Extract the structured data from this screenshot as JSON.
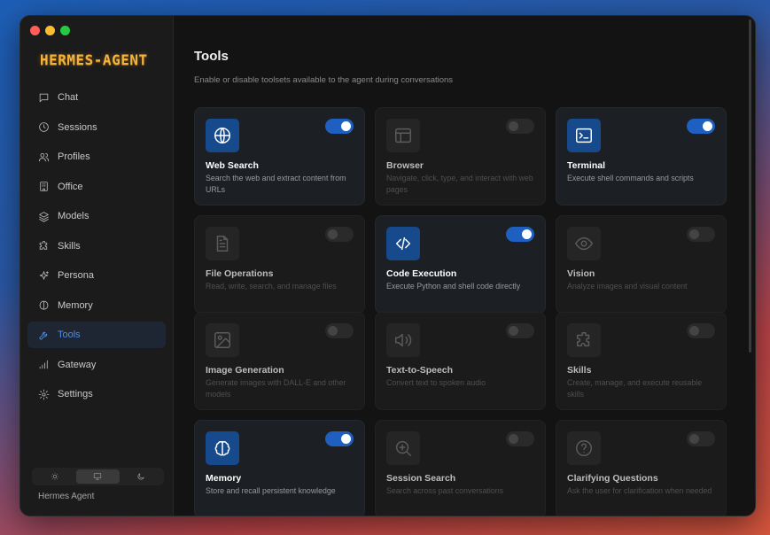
{
  "app": {
    "logo": "HERMES-AGENT",
    "footer_name": "Hermes Agent"
  },
  "sidebar": {
    "items": [
      {
        "label": "Chat",
        "icon": "message-square-icon",
        "active": false
      },
      {
        "label": "Sessions",
        "icon": "clock-icon",
        "active": false
      },
      {
        "label": "Profiles",
        "icon": "users-icon",
        "active": false
      },
      {
        "label": "Office",
        "icon": "building-icon",
        "active": false
      },
      {
        "label": "Models",
        "icon": "layers-icon",
        "active": false
      },
      {
        "label": "Skills",
        "icon": "puzzle-icon",
        "active": false
      },
      {
        "label": "Persona",
        "icon": "sparkle-icon",
        "active": false
      },
      {
        "label": "Memory",
        "icon": "brain-icon",
        "active": false
      },
      {
        "label": "Tools",
        "icon": "wrench-icon",
        "active": true
      },
      {
        "label": "Gateway",
        "icon": "signal-icon",
        "active": false
      },
      {
        "label": "Settings",
        "icon": "gear-icon",
        "active": false
      }
    ],
    "theme_options": [
      "light",
      "system",
      "dark"
    ],
    "theme_selected": "system"
  },
  "page": {
    "title": "Tools",
    "subtitle": "Enable or disable toolsets available to the agent during conversations"
  },
  "tools": [
    {
      "name": "Web Search",
      "description": "Search the web and extract content from URLs",
      "icon": "globe-icon",
      "enabled": true
    },
    {
      "name": "Browser",
      "description": "Navigate, click, type, and interact with web pages",
      "icon": "browser-window-icon",
      "enabled": false
    },
    {
      "name": "Terminal",
      "description": "Execute shell commands and scripts",
      "icon": "terminal-icon",
      "enabled": true
    },
    {
      "name": "File Operations",
      "description": "Read, write, search, and manage files",
      "icon": "file-text-icon",
      "enabled": false
    },
    {
      "name": "Code Execution",
      "description": "Execute Python and shell code directly",
      "icon": "code-icon",
      "enabled": true
    },
    {
      "name": "Vision",
      "description": "Analyze images and visual content",
      "icon": "eye-icon",
      "enabled": false
    },
    {
      "name": "Image Generation",
      "description": "Generate images with DALL-E and other models",
      "icon": "image-icon",
      "enabled": false
    },
    {
      "name": "Text-to-Speech",
      "description": "Convert text to spoken audio",
      "icon": "speaker-icon",
      "enabled": false
    },
    {
      "name": "Skills",
      "description": "Create, manage, and execute reusable skills",
      "icon": "puzzle-icon",
      "enabled": false
    },
    {
      "name": "Memory",
      "description": "Store and recall persistent knowledge",
      "icon": "brain-icon",
      "enabled": true
    },
    {
      "name": "Session Search",
      "description": "Search across past conversations",
      "icon": "search-plus-icon",
      "enabled": false
    },
    {
      "name": "Clarifying Questions",
      "description": "Ask the user for clarification when needed",
      "icon": "help-circle-icon",
      "enabled": false
    }
  ],
  "colors": {
    "accent": "#1f5fbf",
    "active_nav": "#4d8ff0",
    "logo": "#f2b33d"
  }
}
